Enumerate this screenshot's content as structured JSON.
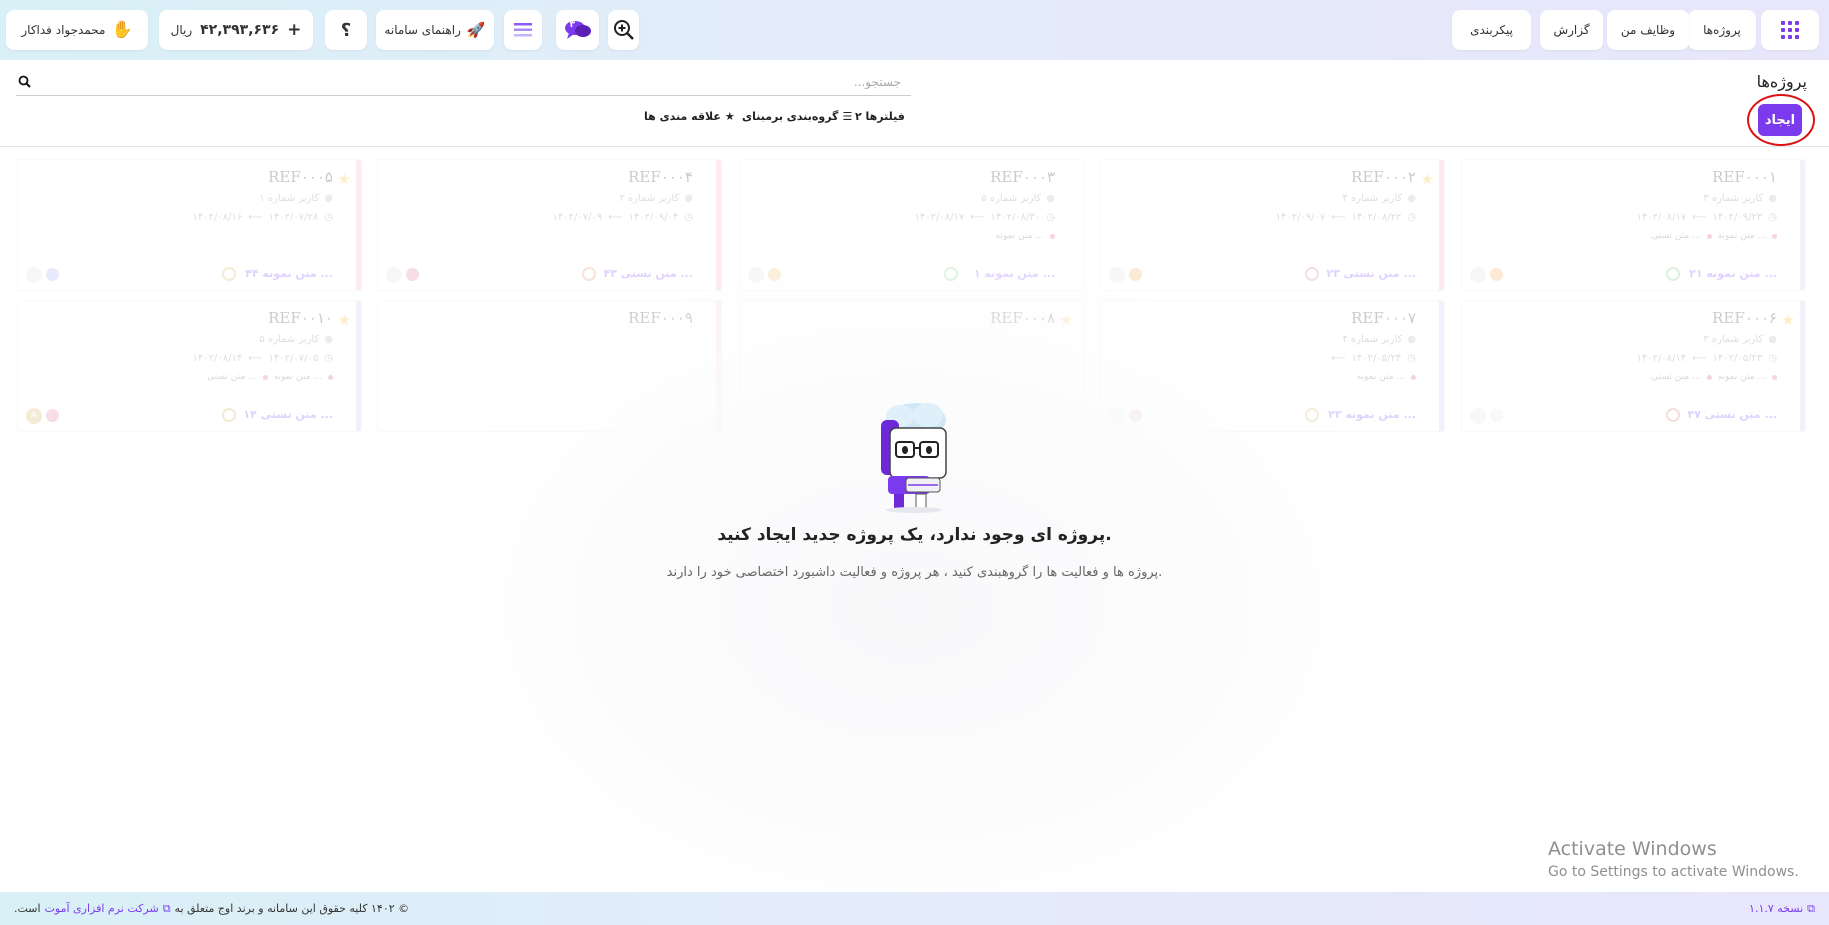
{
  "header": {
    "nav_projects": "پروژه‌ها",
    "nav_my_tasks": "وظایف من",
    "nav_report": "گزارش",
    "nav_config": "پیکربندی",
    "guide_label": "راهنمای سامانه",
    "chat_badge": "۳",
    "help_label": "؟",
    "balance_amount": "۴۲,۳۹۳,۶۳۶",
    "balance_currency": "ریال",
    "balance_plus": "+",
    "user_name": "محمدجواد فداکار"
  },
  "page": {
    "title": "پروژه‌ها",
    "create_label": "ایجاد",
    "search_placeholder": "جستجو...",
    "filters_label": "۲ فیلترها",
    "group_label": "گروه‌بندی برمبنای",
    "favorites_label": "علاقه مندی ها"
  },
  "cards": [
    {
      "ref": "REF۰۰۰۱",
      "user": "کاربر شماره ۳",
      "start": "۱۴۰۲/۰۹/۲۳",
      "end": "۱۴۰۲/۰۸/۱۷",
      "tags": [
        "متن تستی ...",
        "متن نمونه ..."
      ],
      "footer": "۲۱ متن نمونه ...",
      "star": false,
      "accent": "#c9cdf5",
      "dot": "#f4b36b",
      "av": "",
      "clock": "#7ccf8a"
    },
    {
      "ref": "REF۰۰۰۲",
      "user": "کاربر شماره ۴",
      "start": "۱۴۰۲/۰۸/۲۲",
      "end": "۱۴۰۲/۰۹/۰۷",
      "tags": [],
      "footer": "۲۳ متن تستی ...",
      "star": true,
      "accent": "#f5b3bd",
      "dot": "#f4b36b",
      "av": "",
      "clock": "#e08a8a"
    },
    {
      "ref": "REF۰۰۰۳",
      "user": "کاربر شماره ۵",
      "start": "۱۴۰۲/۰۸/۳۰",
      "end": "۱۴۰۲/۰۸/۱۷",
      "tags": [
        "متن نمونه ..."
      ],
      "footer": "۱ متن نمونه ...",
      "star": false,
      "accent": "#ffffff",
      "dot": "#f4c27b",
      "av": "",
      "clock": "#7ccf8a"
    },
    {
      "ref": "REF۰۰۰۴",
      "user": "کاربر شماره ۲",
      "start": "۱۴۰۲/۰۹/۰۴",
      "end": "۱۴۰۲/۰۷/۰۹",
      "tags": [],
      "footer": "۴۳ متن تستی ...",
      "star": false,
      "accent": "#f5b3bd",
      "dot": "#e08a9f",
      "av": "",
      "clock": "#e0a07a"
    },
    {
      "ref": "REF۰۰۰۵",
      "user": "کاربر شماره ۱",
      "start": "۱۴۰۲/۰۷/۲۸",
      "end": "۱۴۰۲/۰۸/۱۶",
      "tags": [],
      "footer": "۴۴ متن نمونه ...",
      "star": true,
      "accent": "#f5b3bd",
      "dot": "#a9b3f2",
      "av": "",
      "clock": "#d9b86a"
    },
    {
      "ref": "REF۰۰۰۶",
      "user": "کاربر شماره ۳",
      "start": "۱۴۰۲/۰۵/۲۳",
      "end": "۱۴۰۲/۰۸/۱۴",
      "tags": [
        "متن تستی ...",
        "متن نمونه ..."
      ],
      "footer": "۴۷ متن تستی ...",
      "star": true,
      "accent": "#c9cdf5",
      "dot": "#e8e8ea",
      "av": "",
      "clock": "#e08a8a"
    },
    {
      "ref": "REF۰۰۰۷",
      "user": "کاربر شماره ۴",
      "start": "۱۴۰۲/۰۵/۲۴",
      "end": "",
      "tags": [
        "متن نمونه ..."
      ],
      "footer": "۲۳ متن نمونه ...",
      "star": false,
      "accent": "#c9cdf5",
      "dot": "#e0a6a6",
      "av": "",
      "clock": "#d9b86a"
    },
    {
      "ref": "REF۰۰۰۸",
      "user": "",
      "start": "",
      "end": "",
      "tags": [],
      "footer": "",
      "star": true,
      "accent": "#ffffff",
      "dot": "#ffffff",
      "av": "",
      "clock": "#ffffff"
    },
    {
      "ref": "REF۰۰۰۹",
      "user": "",
      "start": "",
      "end": "",
      "tags": [],
      "footer": "",
      "star": false,
      "accent": "#f5d0d6",
      "dot": "#e0a6b4",
      "av": "",
      "clock": "#ffffff"
    },
    {
      "ref": "REF۰۰۱۰",
      "user": "کاربر شماره ۵",
      "start": "۱۴۰۲/۰۷/۰۵",
      "end": "۱۴۰۲/۰۸/۱۴",
      "tags": [
        "متن تستی ...",
        "متن نمونه ..."
      ],
      "footer": "۱۴ متن تستی ...",
      "star": true,
      "accent": "#c9cdf5",
      "dot": "#e08aa0",
      "av": "A",
      "clock": "#d9b86a"
    }
  ],
  "empty_state": {
    "title": "پروژه ای وجود ندارد، یک پروژه جدید ایجاد کنید.",
    "subtitle": "پروژه ها و فعالیت ها را گروهبندی کنید ، هر پروژه و فعالیت داشبورد اختصاصی خود را دارند."
  },
  "watermark": {
    "line1": "Activate Windows",
    "line2": "Go to Settings to activate Windows."
  },
  "footer": {
    "copyright": "© ۱۴۰۲ کلیه حقوق این سامانه و برند اوج متعلق به",
    "company": "شرکت نرم افزاری آموت",
    "suffix": "است.",
    "version": "نسخه ۱.۱.۷"
  },
  "colors": {
    "accent": "#7c3aed",
    "highlight_ring": "#dd1111"
  }
}
